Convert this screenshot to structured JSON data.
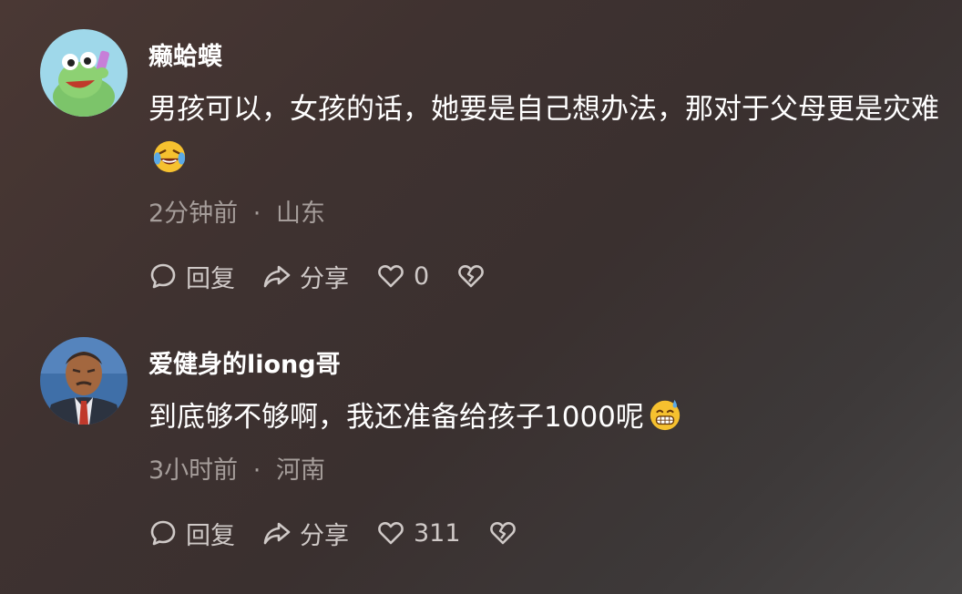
{
  "comments": [
    {
      "username": "癞蛤蟆",
      "text": "男孩可以，女孩的话，她要是自己想办法，那对于父母更是灾难",
      "emoji_icon": "laughing-crying-emoji",
      "time": "2分钟前",
      "separator": "·",
      "location": "山东",
      "reply_label": "回复",
      "share_label": "分享",
      "like_count": "0"
    },
    {
      "username": "爱健身的liong哥",
      "text": "到底够不够啊，我还准备给孩子1000呢",
      "emoji_icon": "grinning-sweat-emoji",
      "time": "3小时前",
      "separator": "·",
      "location": "河南",
      "reply_label": "回复",
      "share_label": "分享",
      "like_count": "311"
    }
  ],
  "colors": {
    "text": "#ffffff",
    "meta": "#a59d9a",
    "action": "#cfc9c7",
    "background": "#3f3230"
  }
}
